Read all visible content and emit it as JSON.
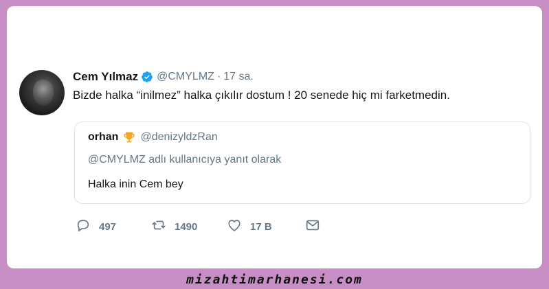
{
  "tweet": {
    "author_name": "Cem Yılmaz",
    "author_handle": "@CMYLMZ",
    "separator": "·",
    "time": "17 sa.",
    "text": "Bizde halka “inilmez” halka çıkılır dostum ! 20 senede hiç mi farketmedin.",
    "verified": true
  },
  "quoted": {
    "author_name": "orhan",
    "author_handle": "@denizyldzRan",
    "reply_context": "@CMYLMZ adlı kullanıcıya yanıt olarak",
    "text": "Halka inin Cem bey",
    "badge_icon": "trophy-icon"
  },
  "actions": {
    "replies": "497",
    "retweets": "1490",
    "likes": "17 B",
    "icons": [
      "reply-icon",
      "retweet-icon",
      "like-icon",
      "message-icon"
    ]
  },
  "footer": {
    "text": "mizahtimarhanesi.com"
  },
  "colors": {
    "frame": "#c88fc6",
    "text": "#14171a",
    "muted": "#657786",
    "verified": "#1da1f2",
    "trophy": "#f5a623"
  }
}
